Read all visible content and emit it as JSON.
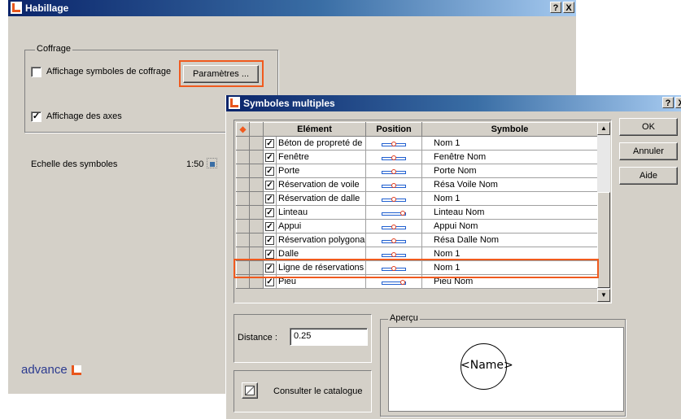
{
  "main_window": {
    "title": "Habillage",
    "help_btn": "?",
    "close_btn": "X",
    "group_label": "Coffrage",
    "checkbox_symbols": {
      "label": "Affichage symboles de coffrage",
      "checked": false,
      "mark": ""
    },
    "params_button": "Paramètres ...",
    "checkbox_axes": {
      "label": "Affichage des axes",
      "checked": true,
      "mark": "✓"
    },
    "scale_label": "Echelle des symboles",
    "scale_value": "1:50",
    "brand": "advance"
  },
  "dialog": {
    "title": "Symboles multiples",
    "help_btn": "?",
    "close_btn": "X",
    "columns": {
      "element": "Elément",
      "position": "Position",
      "symbol": "Symbole"
    },
    "rows": [
      {
        "element": "Béton de propreté de",
        "checked": true,
        "symbol": "Nom 1",
        "dot": "mid"
      },
      {
        "element": "Fenêtre",
        "checked": true,
        "symbol": "Fenêtre Nom",
        "dot": "mid"
      },
      {
        "element": "Porte",
        "checked": true,
        "symbol": "Porte Nom",
        "dot": "mid"
      },
      {
        "element": "Réservation de voile",
        "checked": true,
        "symbol": "Résa Voile Nom",
        "dot": "mid"
      },
      {
        "element": "Réservation de dalle",
        "checked": true,
        "symbol": "Nom 1",
        "dot": "mid"
      },
      {
        "element": "Linteau",
        "checked": true,
        "symbol": "Linteau Nom",
        "dot": "right"
      },
      {
        "element": "Appui",
        "checked": true,
        "symbol": "Appui Nom",
        "dot": "mid"
      },
      {
        "element": "Réservation polygonal",
        "checked": true,
        "symbol": "Résa Dalle Nom",
        "dot": "mid"
      },
      {
        "element": "Dalle",
        "checked": true,
        "symbol": "Nom 1",
        "dot": "mid"
      },
      {
        "element": "Ligne de réservations",
        "checked": true,
        "symbol": "Nom 1",
        "dot": "mid"
      },
      {
        "element": "Pieu",
        "checked": true,
        "symbol": "Pieu Nom",
        "dot": "right"
      }
    ],
    "highlighted_row": "Ligne de réservations",
    "ok_button": "OK",
    "cancel_button": "Annuler",
    "help_button": "Aide",
    "distance_label": "Distance :",
    "distance_value": "0.25",
    "catalog_button": "Consulter le catalogue",
    "preview_label": "Aperçu",
    "preview_text": "<Name>"
  },
  "colors": {
    "accent": "#f05a1e",
    "titlebar": "#0a246a",
    "face": "#d4d0c8",
    "position_blue": "#1f5fd0",
    "position_red": "#e03a1a"
  }
}
